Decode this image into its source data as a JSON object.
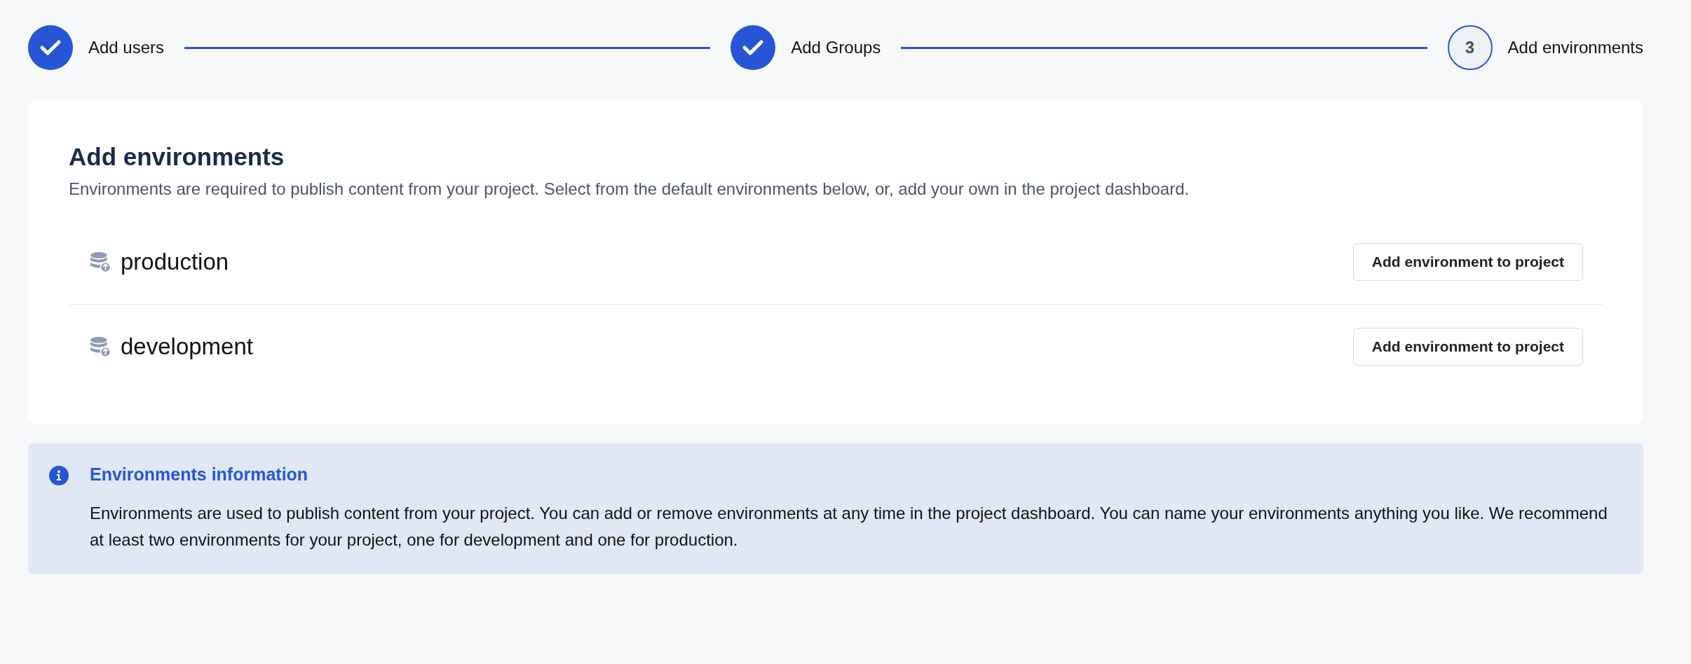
{
  "steps": [
    {
      "label": "Add users",
      "completed": true
    },
    {
      "label": "Add Groups",
      "completed": true
    },
    {
      "number": "3",
      "label": "Add environments",
      "completed": false
    }
  ],
  "card": {
    "title": "Add environments",
    "description": "Environments are required to publish content from your project. Select from the default environments below, or, add your own in the project dashboard.",
    "environments": [
      {
        "name": "production",
        "button": "Add environment to project"
      },
      {
        "name": "development",
        "button": "Add environment to project"
      }
    ]
  },
  "info": {
    "title": "Environments information",
    "text": "Environments are used to publish content from your project. You can add or remove environments at any time in the project dashboard. You can name your environments anything you like. We recommend at least two environments for your project, one for development and one for production."
  }
}
